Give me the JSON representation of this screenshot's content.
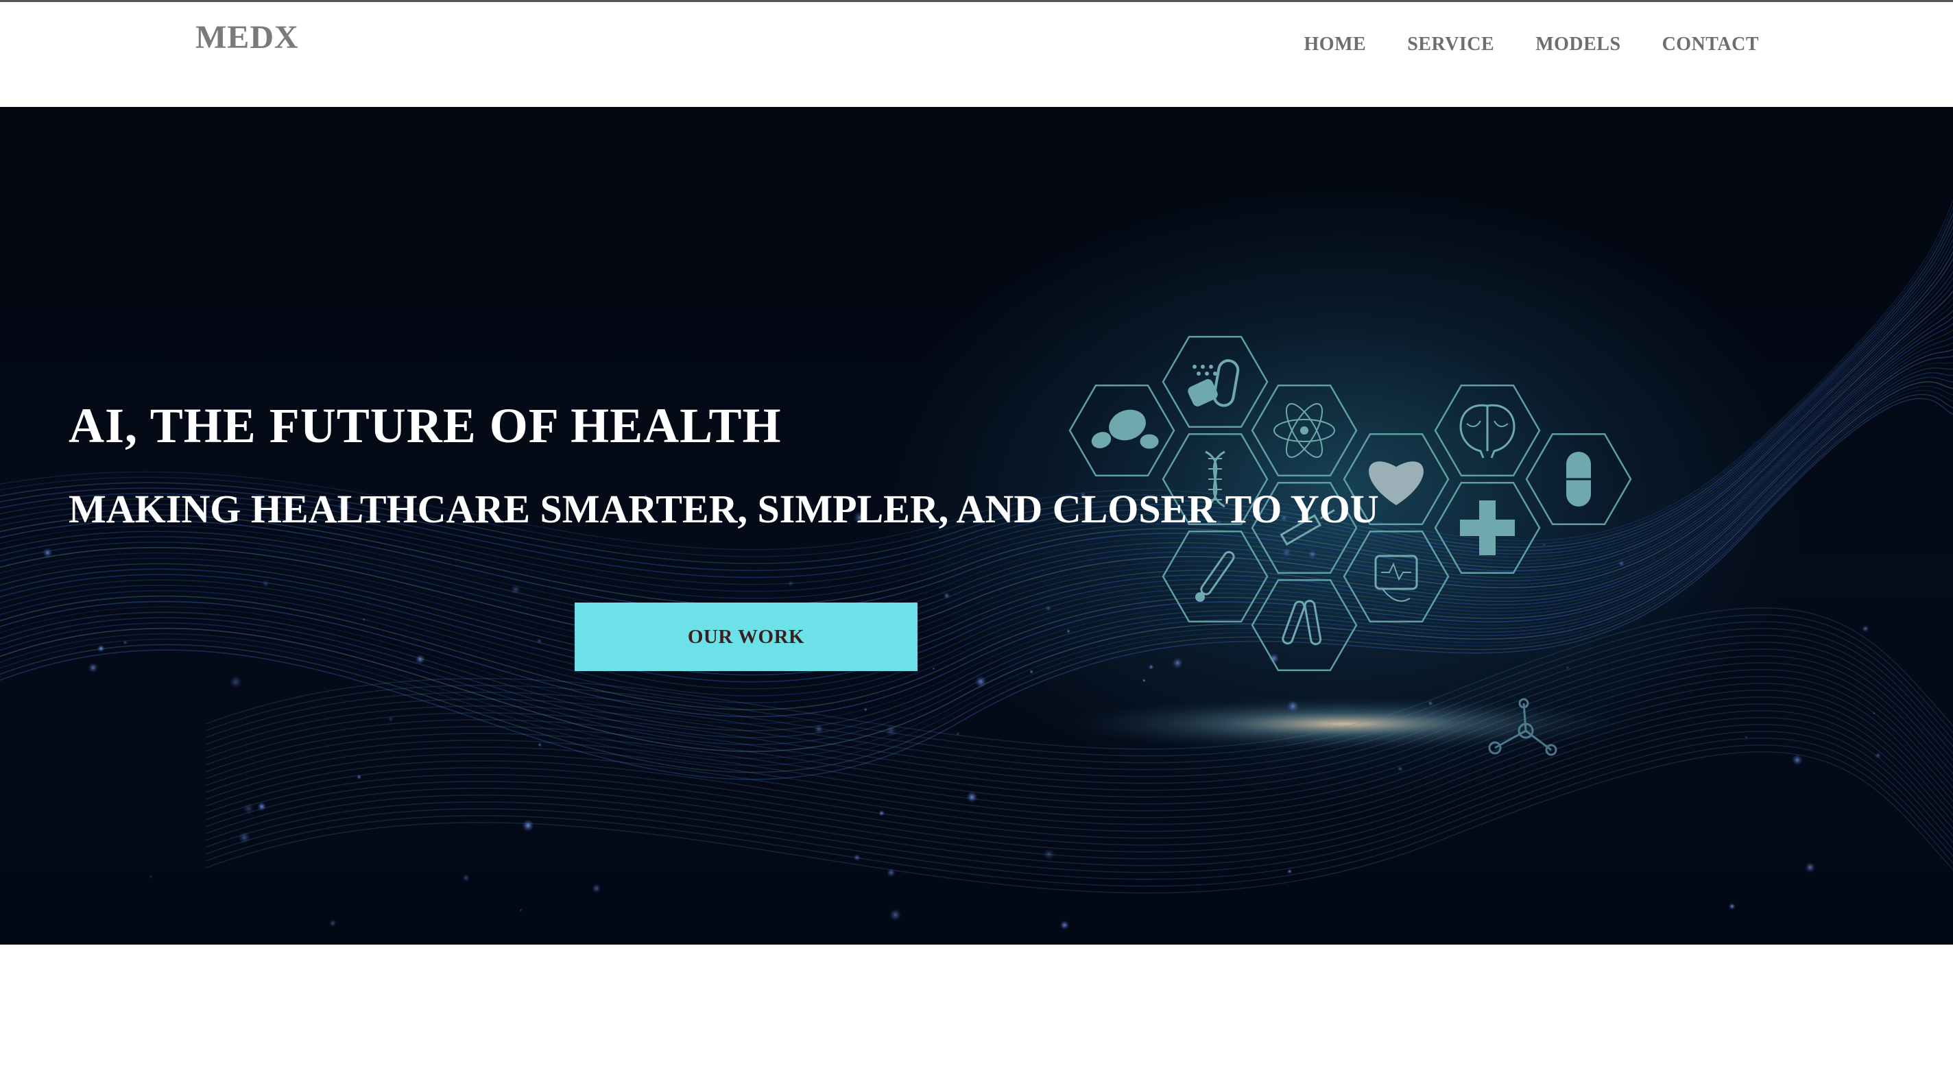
{
  "header": {
    "logo": "MEDX",
    "nav": [
      {
        "label": "HOME"
      },
      {
        "label": "SERVICE"
      },
      {
        "label": "MODELS"
      },
      {
        "label": "CONTACT"
      }
    ]
  },
  "hero": {
    "title": "AI, THE FUTURE OF HEALTH",
    "subtitle": "MAKING HEALTHCARE SMARTER, SIMPLER, AND CLOSER TO YOU",
    "cta_label": "OUR WORK",
    "icons": [
      "pills-icon",
      "capsule-bottle-icon",
      "dna-icon",
      "atom-icon",
      "syringe-icon",
      "heart-icon",
      "brain-icon",
      "medical-cross-icon",
      "capsule-icon",
      "thermometer-icon",
      "test-tubes-icon",
      "heart-monitor-icon"
    ]
  },
  "colors": {
    "accent": "#6de1e8",
    "hero_bg": "#040b19",
    "icon_stroke": "#6fa9ad",
    "nav_text": "#6e6e6e"
  }
}
